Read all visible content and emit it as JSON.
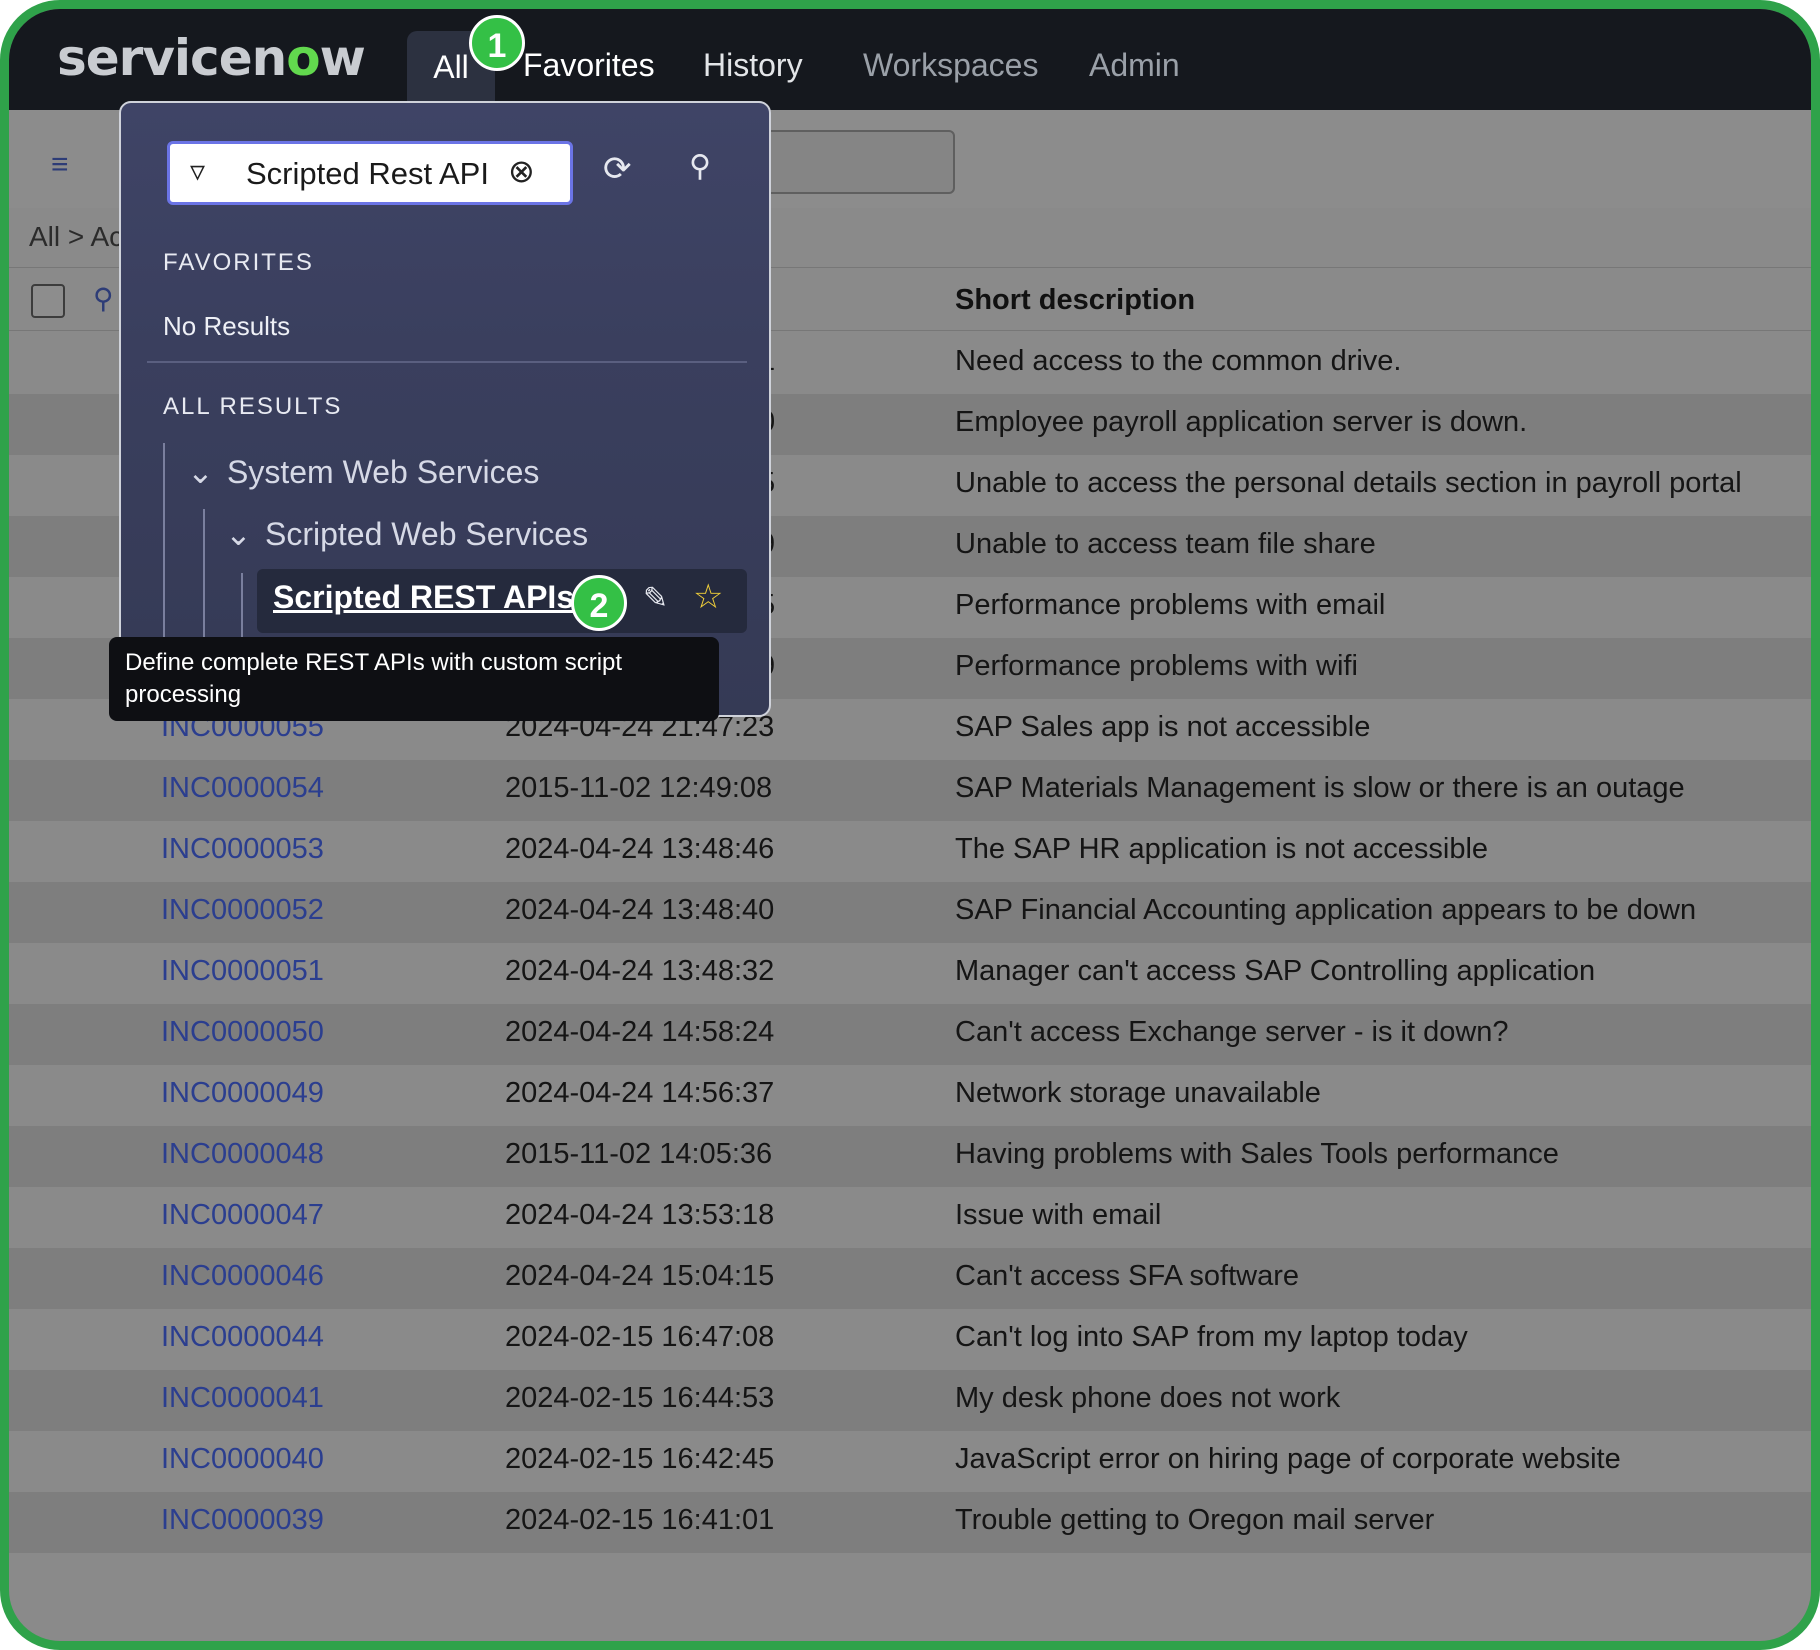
{
  "nav": {
    "logo_part1": "servicen",
    "logo_o": "o",
    "logo_part2": "w",
    "tabs": [
      {
        "label": "All"
      },
      {
        "label": "Favorites"
      },
      {
        "label": "History"
      },
      {
        "label": "Workspaces"
      },
      {
        "label": "Admin"
      }
    ]
  },
  "badges": {
    "step1": "1",
    "step2": "2"
  },
  "breadcrumb": "All > Ac",
  "list": {
    "short_description_header": "Short description",
    "rows": [
      {
        "opened_tail": "1",
        "desc": "Need access to the common drive."
      },
      {
        "opened_tail": "0",
        "desc": "Employee payroll application server is down."
      },
      {
        "opened_tail": "5",
        "desc": "Unable to access the personal details section in payroll portal"
      },
      {
        "opened_tail": "9",
        "desc": "Unable to access team file share"
      },
      {
        "opened_tail": "5",
        "desc": "Performance problems with email"
      },
      {
        "opened_tail": "9",
        "desc": "Performance problems with wifi"
      },
      {
        "number": "INC0000055",
        "opened": "2024-04-24 21:47:23",
        "desc": "SAP Sales app is not accessible"
      },
      {
        "number": "INC0000054",
        "opened": "2015-11-02 12:49:08",
        "desc": "SAP Materials Management is slow or there is an outage"
      },
      {
        "number": "INC0000053",
        "opened": "2024-04-24 13:48:46",
        "desc": "The SAP HR application is not accessible"
      },
      {
        "number": "INC0000052",
        "opened": "2024-04-24 13:48:40",
        "desc": "SAP Financial Accounting application appears to be down"
      },
      {
        "number": "INC0000051",
        "opened": "2024-04-24 13:48:32",
        "desc": "Manager can't access SAP Controlling application"
      },
      {
        "number": "INC0000050",
        "opened": "2024-04-24 14:58:24",
        "desc": "Can't access Exchange server - is it down?"
      },
      {
        "number": "INC0000049",
        "opened": "2024-04-24 14:56:37",
        "desc": "Network storage unavailable"
      },
      {
        "number": "INC0000048",
        "opened": "2015-11-02 14:05:36",
        "desc": "Having problems with Sales Tools performance"
      },
      {
        "number": "INC0000047",
        "opened": "2024-04-24 13:53:18",
        "desc": "Issue with email"
      },
      {
        "number": "INC0000046",
        "opened": "2024-04-24 15:04:15",
        "desc": "Can't access SFA software"
      },
      {
        "number": "INC0000044",
        "opened": "2024-02-15 16:47:08",
        "desc": "Can't log into SAP from my laptop today"
      },
      {
        "number": "INC0000041",
        "opened": "2024-02-15 16:44:53",
        "desc": "My desk phone does not work"
      },
      {
        "number": "INC0000040",
        "opened": "2024-02-15 16:42:45",
        "desc": "JavaScript error on hiring page of corporate website"
      },
      {
        "number": "INC0000039",
        "opened": "2024-02-15 16:41:01",
        "desc": "Trouble getting to Oregon mail server"
      }
    ]
  },
  "menu": {
    "filter_value": "Scripted Rest API",
    "favorites_label": "FAVORITES",
    "no_results": "No Results",
    "all_results_label": "ALL RESULTS",
    "tree": {
      "level1": "System Web Services",
      "level2": "Scripted Web Services",
      "level3": "Scripted REST APIs"
    }
  },
  "tooltip": "Define complete REST APIs with custom script processing",
  "colors": {
    "accent_green": "#34c046",
    "link_blue": "#2b3e8f",
    "star_yellow": "#f1cf3a"
  }
}
